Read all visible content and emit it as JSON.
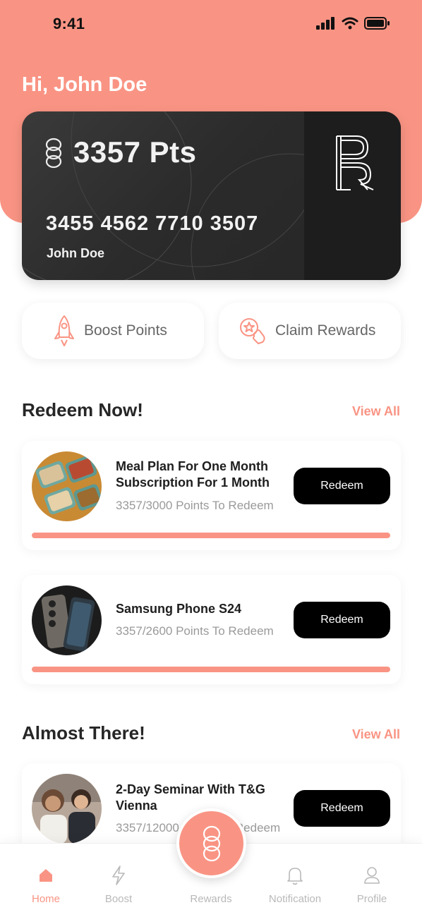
{
  "status_bar": {
    "time": "9:41"
  },
  "greeting": "Hi, John Doe",
  "card": {
    "points": "3357 Pts",
    "number": "3455 4562 7710 3507",
    "holder": "John Doe"
  },
  "actions": [
    {
      "label": "Boost Points",
      "icon": "rocket-icon"
    },
    {
      "label": "Claim Rewards",
      "icon": "star-hand-icon"
    }
  ],
  "redeem_now": {
    "title": "Redeem Now!",
    "view_all": "View All",
    "items": [
      {
        "title": "Meal Plan For One Month Subscription For 1 Month",
        "progress_text": "3357/3000 Points To Redeem",
        "button": "Redeem",
        "progress": 1.0
      },
      {
        "title": "Samsung Phone S24",
        "progress_text": "3357/2600 Points To Redeem",
        "button": "Redeem",
        "progress": 1.0
      }
    ]
  },
  "almost_there": {
    "title": "Almost There!",
    "view_all": "View All",
    "items": [
      {
        "title": "2-Day Seminar With T&G Vienna",
        "progress_text": "3357/12000 Points To Redeem",
        "button": "Redeem"
      }
    ]
  },
  "tabs": [
    {
      "label": "Home",
      "icon": "home-icon",
      "active": true
    },
    {
      "label": "Boost",
      "icon": "bolt-icon"
    },
    {
      "label": "Rewards",
      "icon": "rings-icon"
    },
    {
      "label": "Notification",
      "icon": "bell-icon"
    },
    {
      "label": "Profile",
      "icon": "user-icon"
    }
  ],
  "colors": {
    "accent": "#f99484",
    "card": "#2b2b2b",
    "button": "#000000"
  }
}
